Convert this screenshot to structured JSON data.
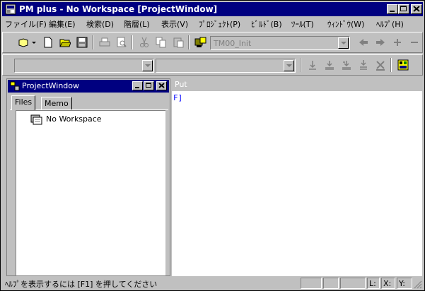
{
  "window": {
    "title": "PM plus - No Workspace  [ProjectWindow]"
  },
  "menu": {
    "items": [
      "ファイル(F)",
      "編集(E)",
      "検索(D)",
      "階層(L)",
      "表示(V)",
      "ﾌﾟﾛｼﾞｪｸﾄ(P)",
      "ﾋﾞﾙﾄﾞ(B)",
      "ﾂｰﾙ(T)",
      "ｳｨﾝﾄﾞｳ(W)",
      "ﾍﾙﾌﾟ(H)"
    ]
  },
  "toolbar": {
    "project_combo_value": "TM00_Init"
  },
  "icons": {
    "toolbar1": [
      "open-dropdown-icon",
      "new-file-icon",
      "open-folder-icon",
      "save-icon",
      "print-icon",
      "print-preview-icon",
      "cut-icon",
      "copy-icon",
      "paste-icon",
      "project-settings-icon",
      "back-arrow-icon",
      "forward-arrow-icon",
      "plus-icon",
      "minus-icon"
    ],
    "toolbar2": [
      "step-into-icon",
      "step-over-icon",
      "step-return-icon",
      "step-down-icon",
      "stop-build-icon",
      "build-all-icon"
    ]
  },
  "project_window": {
    "title": "ProjectWindow",
    "tabs": [
      "Files",
      "Memo"
    ],
    "active_tab": "Files",
    "tree_root": "No Workspace"
  },
  "output": {
    "header": "Put",
    "content": "F]"
  },
  "status": {
    "help_text": "ﾍﾙﾌﾟを表示するには [F1] を押してください",
    "line_label": "L:",
    "x_label": "X:",
    "y_label": "Y:"
  },
  "colors": {
    "titlebar": "#000080",
    "face": "#c0c0c0",
    "output_text": "#0000ff"
  }
}
